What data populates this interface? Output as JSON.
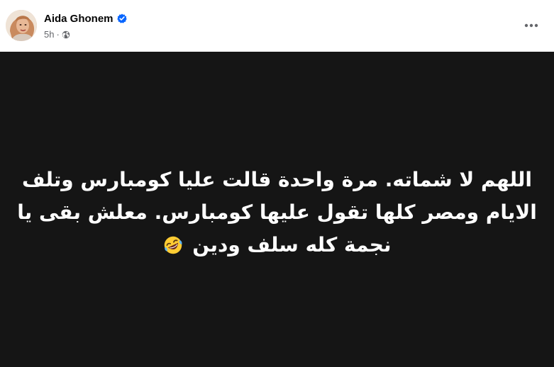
{
  "post": {
    "author": "Aida Ghonem",
    "timestamp": "5h",
    "separator": "·",
    "privacy_icon": "globe-icon",
    "verified_icon": "verified-badge-icon",
    "more_icon": "more-options-icon",
    "text_line1": "اللهم لا شماته. مرة واحدة قالت عليا كومبارس وتلف",
    "text_line2": "الايام ومصر كلها تقول عليها كومبارس. معلش بقى يا",
    "text_line3": "نجمة كله سلف ودين",
    "emoji": "rolling-on-floor-laughing-emoji",
    "background_color": "#151515",
    "text_color": "#ffffff",
    "accent_color": "#0866ff"
  }
}
